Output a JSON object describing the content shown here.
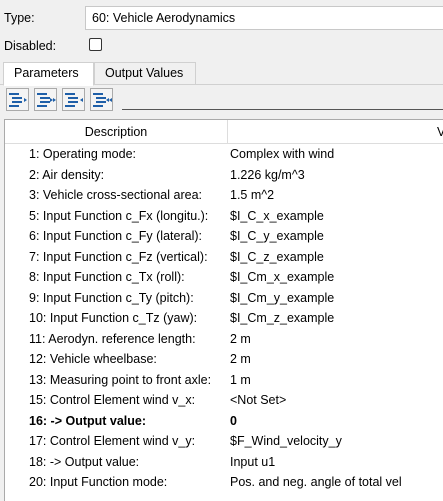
{
  "type_row": {
    "label": "Type:",
    "value": "60: Vehicle Aerodynamics"
  },
  "disabled_row": {
    "label": "Disabled:",
    "checked": false
  },
  "tabs": [
    {
      "label": "Parameters",
      "active": true
    },
    {
      "label": "Output Values",
      "active": false
    }
  ],
  "toolbar": {
    "buttons": [
      "indent-left-icon",
      "indent-left-double-icon",
      "indent-right-icon",
      "indent-right-double-icon"
    ],
    "input_value": ""
  },
  "grid": {
    "col_description": "Description",
    "col_value": "V",
    "rows": [
      {
        "desc": "1: Operating mode:",
        "value": "Complex with wind",
        "bold": false
      },
      {
        "desc": "2: Air density:",
        "value": "1.226 kg/m^3",
        "bold": false
      },
      {
        "desc": "3: Vehicle cross-sectional area:",
        "value": "1.5 m^2",
        "bold": false
      },
      {
        "desc": "5: Input Function c_Fx (longitu.):",
        "value": "$I_C_x_example",
        "bold": false
      },
      {
        "desc": "6: Input Function c_Fy (lateral):",
        "value": "$I_C_y_example",
        "bold": false
      },
      {
        "desc": "7: Input Function c_Fz (vertical):",
        "value": "$I_C_z_example",
        "bold": false
      },
      {
        "desc": "8: Input Function c_Tx (roll):",
        "value": "$I_Cm_x_example",
        "bold": false
      },
      {
        "desc": "9: Input Function c_Ty (pitch):",
        "value": "$I_Cm_y_example",
        "bold": false
      },
      {
        "desc": "10: Input Function c_Tz (yaw):",
        "value": "$I_Cm_z_example",
        "bold": false
      },
      {
        "desc": "11: Aerodyn. reference length:",
        "value": "2 m",
        "bold": false
      },
      {
        "desc": "12: Vehicle wheelbase:",
        "value": "2 m",
        "bold": false
      },
      {
        "desc": "13: Measuring point to front axle:",
        "value": "1 m",
        "bold": false
      },
      {
        "desc": "15: Control Element wind v_x:",
        "value": "<Not Set>",
        "bold": false
      },
      {
        "desc": "16: -> Output value:",
        "value": "0",
        "bold": true
      },
      {
        "desc": "17: Control Element wind v_y:",
        "value": "$F_Wind_velocity_y",
        "bold": false
      },
      {
        "desc": "18: -> Output value:",
        "value": " Input u1",
        "bold": false
      },
      {
        "desc": "20: Input Function mode:",
        "value": "Pos. and neg. angle of total vel",
        "bold": false
      }
    ]
  }
}
